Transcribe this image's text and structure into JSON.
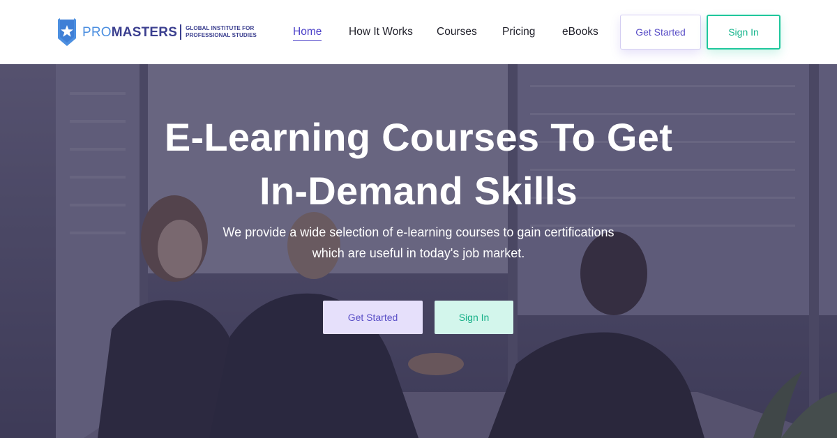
{
  "logo": {
    "word_pro": "PRO",
    "word_masters": "MASTERS",
    "tagline_line1": "GLOBAL INSTITUTE FOR",
    "tagline_line2": "PROFESSIONAL STUDIES",
    "icon": "star-shield-icon"
  },
  "nav": {
    "items": [
      {
        "label": "Home",
        "active": true
      },
      {
        "label": "How It Works",
        "active": false
      },
      {
        "label": "Courses",
        "active": false
      },
      {
        "label": "Pricing",
        "active": false
      },
      {
        "label": "eBooks",
        "active": false
      }
    ]
  },
  "header_buttons": {
    "get_started": "Get Started",
    "sign_in": "Sign In"
  },
  "hero": {
    "title_line1": "E-Learning Courses To Get",
    "title_line2": "In-Demand Skills",
    "subtitle_line1": "We provide a wide selection of e-learning courses to gain certifications",
    "subtitle_line2": "which are useful in today's job market.",
    "get_started": "Get Started",
    "sign_in": "Sign In"
  },
  "colors": {
    "brand_purple": "#4a3fc8",
    "brand_green": "#1fc79c",
    "logo_blue": "#4c8fe0",
    "logo_navy": "#3b3f8f"
  }
}
